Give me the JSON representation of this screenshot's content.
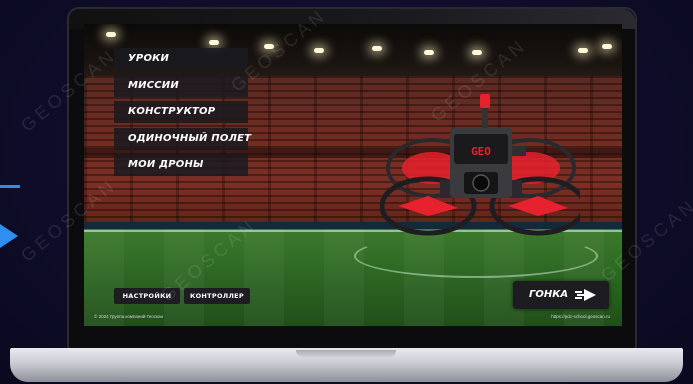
{
  "menu": {
    "items": [
      {
        "label": "УРОКИ"
      },
      {
        "label": "МИССИИ"
      },
      {
        "label": "КОНСТРУКТОР"
      },
      {
        "label": "ОДИНОЧНЫЙ ПОЛЕТ"
      },
      {
        "label": "МОИ ДРОНЫ"
      }
    ]
  },
  "bottom_bar": {
    "settings_label": "НАСТРОЙКИ",
    "controller_label": "КОНТРОЛЛЕР",
    "race_label": "ГОНКА"
  },
  "footer": {
    "copyright": "© 2024 Группа компаний Геоскан",
    "url": "https://pdc-school.geoscan.ru"
  },
  "watermark": "GEOSCAN",
  "drone": {
    "display_text": "GEO"
  },
  "icons": {
    "race": "arrow-right-icon"
  },
  "colors": {
    "background": "#0f0d2a",
    "accent_arrow": "#2f8ff0",
    "menu_bg": "#1a1a20",
    "drone_red": "#e8212e"
  }
}
